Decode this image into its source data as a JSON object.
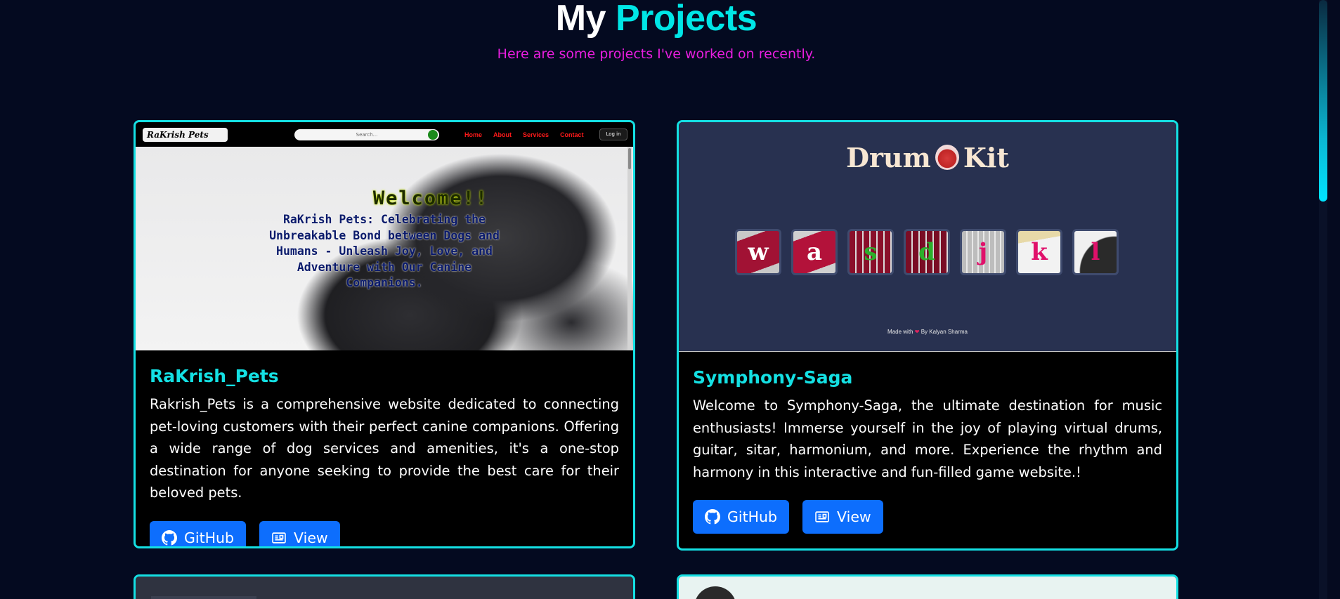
{
  "header": {
    "title_plain": "My",
    "title_accent": "Projects",
    "subtitle": "Here are some projects I've worked on recently."
  },
  "projects": [
    {
      "title": "RaKrish_Pets",
      "description": "Rakrish_Pets is a comprehensive website dedicated to connecting pet-loving customers with their perfect canine companions. Offering a wide range of dog services and amenities, it's a one-stop destination for anyone seeking to provide the best care for their beloved pets.",
      "github_label": "GitHub",
      "view_label": "View",
      "preview": {
        "logo": "RaKrish Pets",
        "search_placeholder": "Search...",
        "nav": [
          "Home",
          "About",
          "Services",
          "Contact"
        ],
        "login": "Log in",
        "welcome": "Welcome!!",
        "tagline": "RaKrish Pets: Celebrating the Unbreakable Bond between Dogs and Humans - Unleash Joy, Love, and Adventure with Our Canine Companions."
      }
    },
    {
      "title": "Symphony-Saga",
      "description": "Welcome to Symphony-Saga, the ultimate destination for music enthusiasts! Immerse yourself in the joy of playing virtual drums, guitar, sitar, harmonium, and more. Experience the rhythm and harmony in this interactive and fun-filled game website.!",
      "github_label": "GitHub",
      "view_label": "View",
      "preview": {
        "title_left": "Drum",
        "title_right": "Kit",
        "keys": [
          "w",
          "a",
          "s",
          "d",
          "j",
          "k",
          "l"
        ],
        "key_colors": [
          "#ffffff",
          "#ffffff",
          "#2bb02b",
          "#2bb02b",
          "#e0106a",
          "#e0106a",
          "#e0106a"
        ],
        "footer_prefix": "Made with",
        "footer_suffix": "By Kalyan Sharma"
      }
    }
  ],
  "colors": {
    "accent": "#14e0e3",
    "subtitle": "#e81ee0",
    "button": "#0d6efd",
    "background": "#040a20"
  }
}
